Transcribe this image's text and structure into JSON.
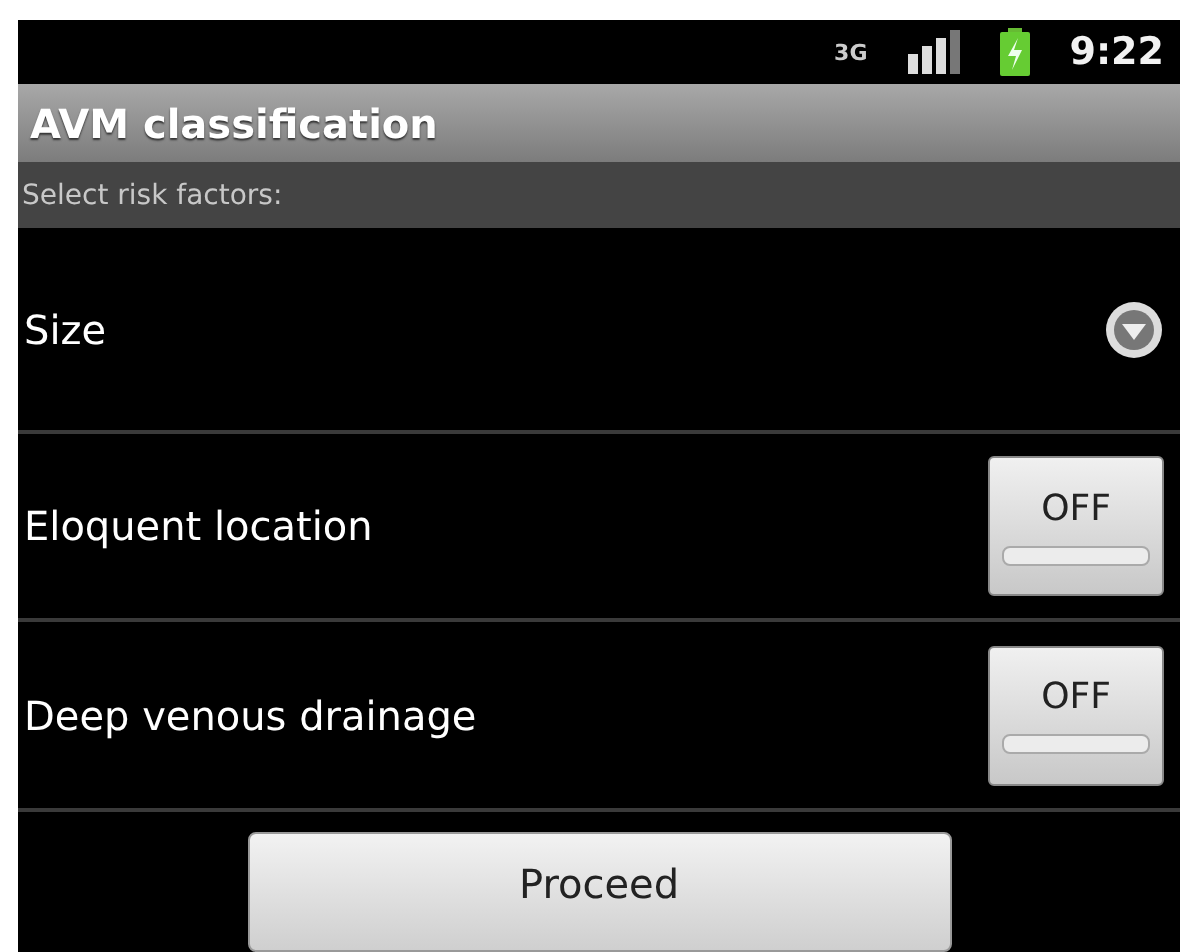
{
  "status_bar": {
    "network": "3G",
    "time": "9:22"
  },
  "title": "AVM classification",
  "subheader": "Select risk factors:",
  "rows": [
    {
      "kind": "dropdown",
      "label": "Size"
    },
    {
      "kind": "toggle",
      "label": "Eloquent location",
      "on": false,
      "toggle_text": "OFF"
    },
    {
      "kind": "toggle",
      "label": "Deep venous drainage",
      "on": false,
      "toggle_text": "OFF"
    }
  ],
  "button": "Proceed"
}
